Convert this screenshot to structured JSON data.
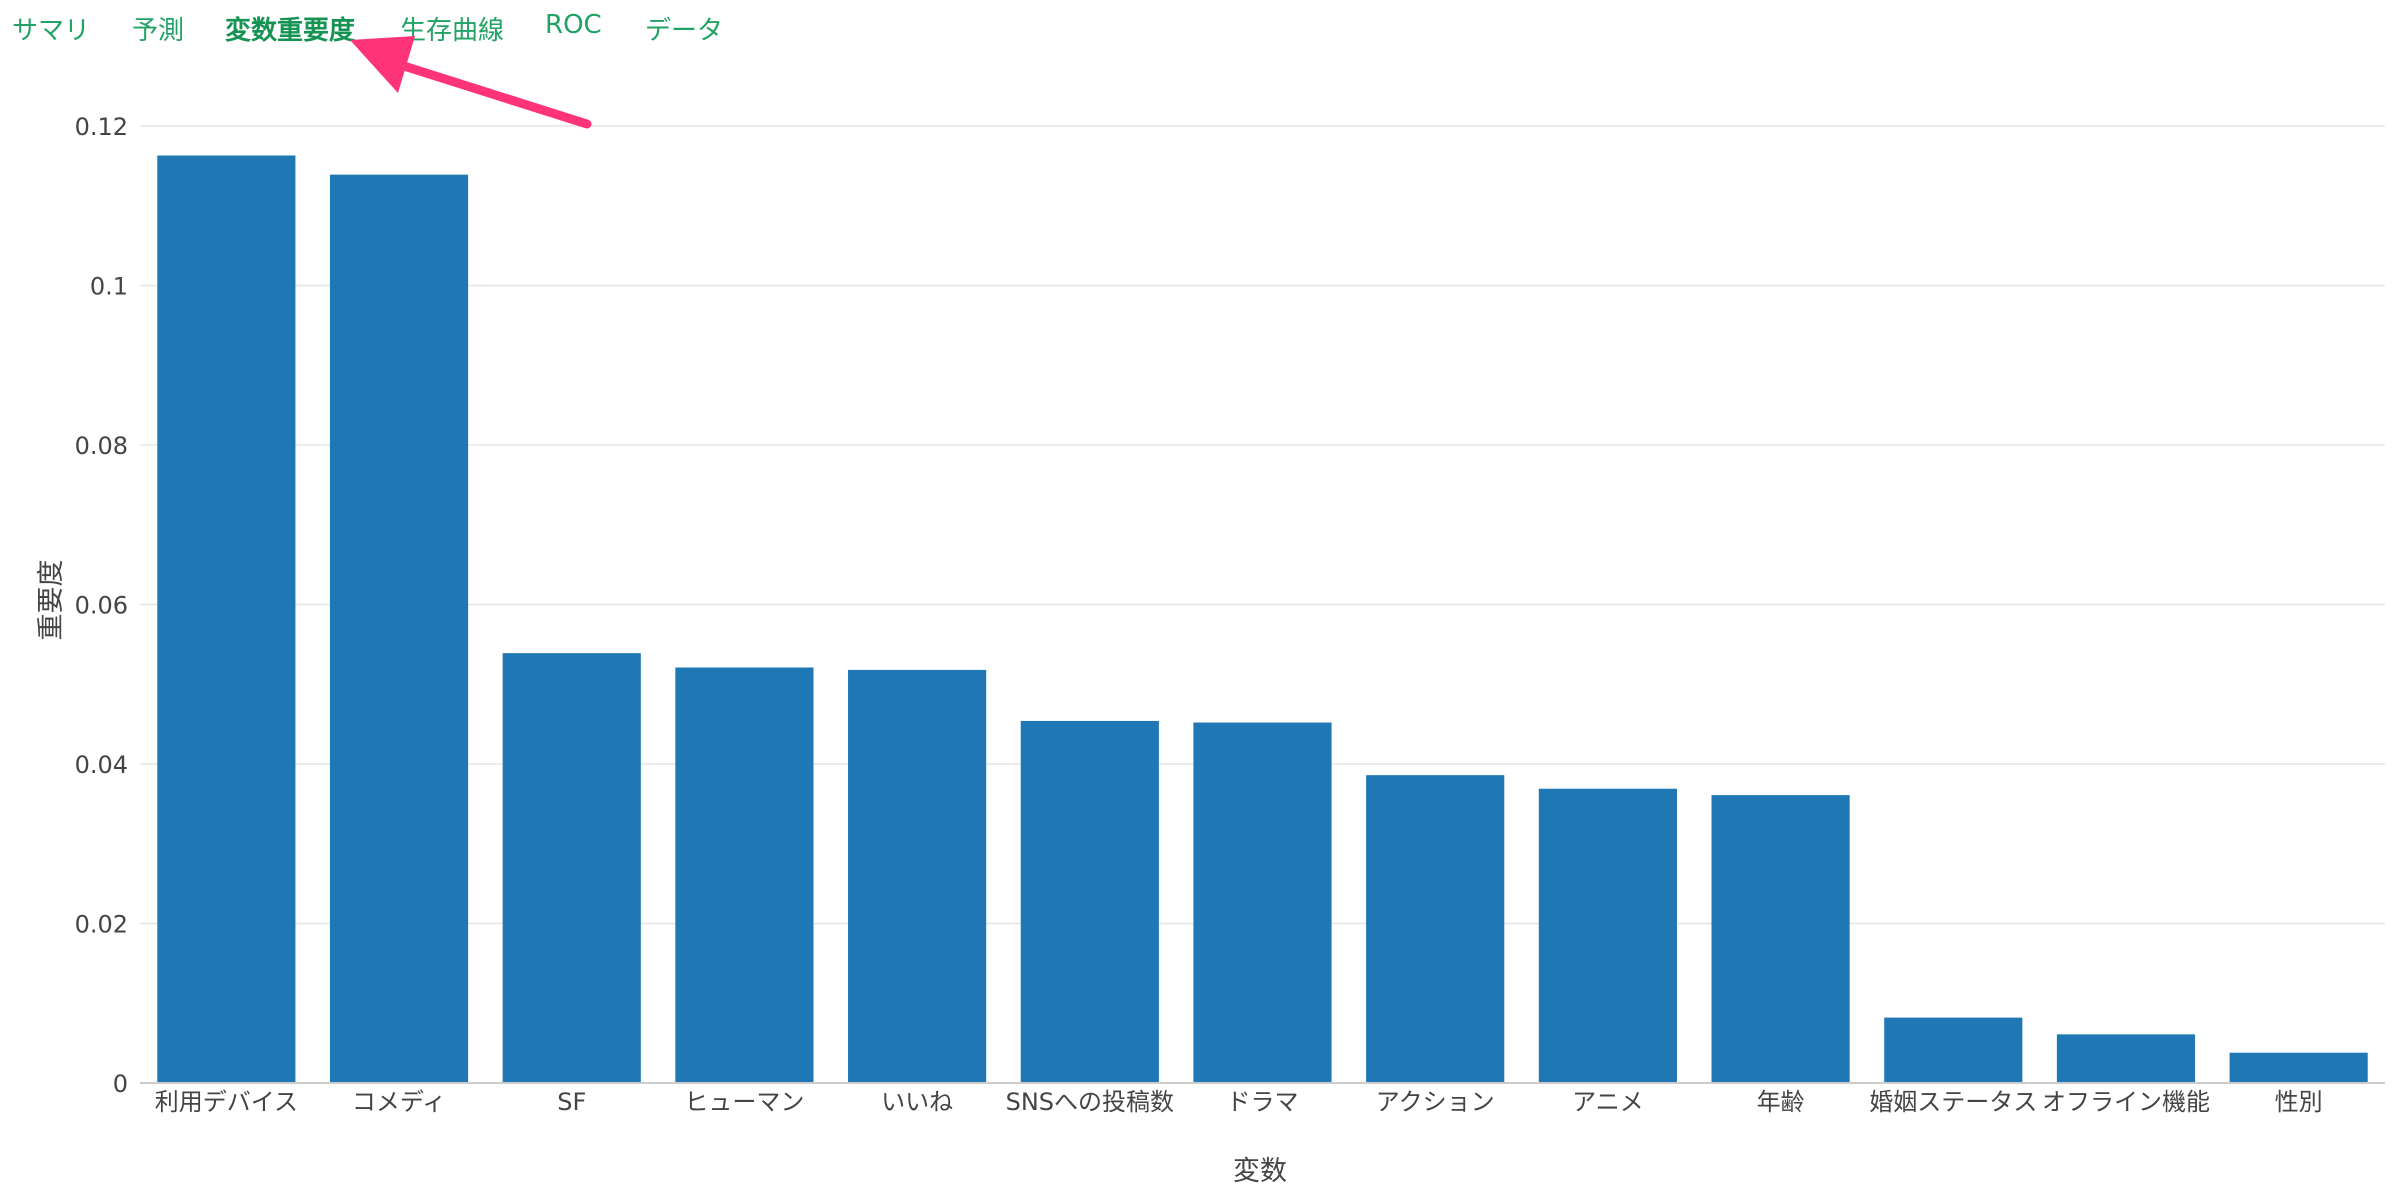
{
  "tabs": [
    {
      "label": "サマリ",
      "active": false
    },
    {
      "label": "予測",
      "active": false
    },
    {
      "label": "変数重要度",
      "active": true
    },
    {
      "label": "生存曲線",
      "active": false
    },
    {
      "label": "ROC",
      "active": false
    },
    {
      "label": "データ",
      "active": false
    }
  ],
  "colors": {
    "tab_text": "#21a366",
    "bar": "#1f77b4",
    "arrow": "#ff3377",
    "grid": "#e6e6e6"
  },
  "chart_data": {
    "type": "bar",
    "categories": [
      "利用デバイス",
      "コメディ",
      "SF",
      "ヒューマン",
      "いいね",
      "SNSへの投稿数",
      "ドラマ",
      "アクション",
      "アニメ",
      "年齢",
      "婚姻ステータス",
      "オフライン機能",
      "性別"
    ],
    "values": [
      0.1163,
      0.1139,
      0.0539,
      0.0521,
      0.0518,
      0.0454,
      0.0452,
      0.0386,
      0.0369,
      0.0361,
      0.0082,
      0.0061,
      0.0038
    ],
    "xlabel": "変数",
    "ylabel": "重要度",
    "ylim": [
      0,
      0.12
    ],
    "yticks": [
      0,
      0.02,
      0.04,
      0.06,
      0.08,
      0.1,
      0.12
    ],
    "ytick_labels": [
      "0",
      "0.02",
      "0.04",
      "0.06",
      "0.08",
      "0.1",
      "0.12"
    ],
    "grid": true
  }
}
